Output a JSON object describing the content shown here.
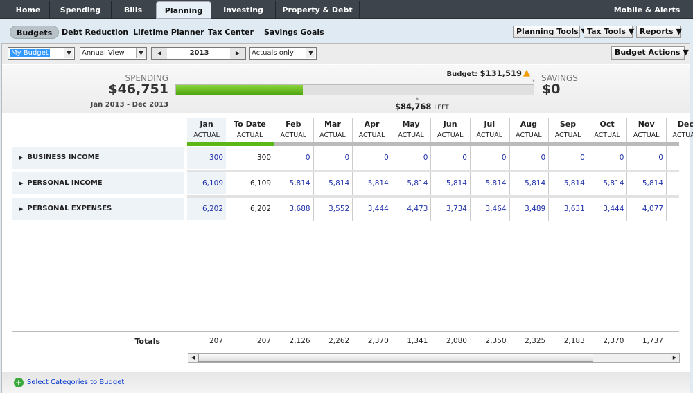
{
  "topnav": {
    "tabs": [
      "Home",
      "Spending",
      "Bills",
      "Planning",
      "Investing",
      "Property & Debt"
    ],
    "active": "Planning",
    "right": "Mobile & Alerts"
  },
  "subnav": {
    "items": [
      "Budgets",
      "Debt Reduction",
      "Lifetime Planner",
      "Tax Center",
      "Savings Goals"
    ],
    "active": "Budgets",
    "tools": [
      "Planning Tools",
      "Tax Tools",
      "Reports"
    ]
  },
  "toolbar": {
    "budget": "My Budget",
    "view": "Annual View",
    "year": "2013",
    "filter": "Actuals only",
    "actions": "Budget Actions"
  },
  "summary": {
    "spending_label": "SPENDING",
    "spending": "$46,751",
    "range": "Jan 2013 - Dec 2013",
    "budget_label": "Budget:",
    "budget": "$131,519",
    "left": "$84,768",
    "left_label": "LEFT",
    "savings_label": "SAVINGS",
    "savings": "$0",
    "progress_fraction": 0.355,
    "accent": "#5cb818",
    "warning_icon": "warning-triangle-icon"
  },
  "grid": {
    "columns": [
      {
        "m": "Jan",
        "s": "ACTUAL"
      },
      {
        "m": "To Date",
        "s": "ACTUAL"
      },
      {
        "m": "Feb",
        "s": "ACTUAL"
      },
      {
        "m": "Mar",
        "s": "ACTUAL"
      },
      {
        "m": "Apr",
        "s": "ACTUAL"
      },
      {
        "m": "May",
        "s": "ACTUAL"
      },
      {
        "m": "Jun",
        "s": "ACTUAL"
      },
      {
        "m": "Jul",
        "s": "ACTUAL"
      },
      {
        "m": "Aug",
        "s": "ACTUAL"
      },
      {
        "m": "Sep",
        "s": "ACTUAL"
      },
      {
        "m": "Oct",
        "s": "ACTUAL"
      },
      {
        "m": "Nov",
        "s": "ACTUAL"
      },
      {
        "m": "Dec",
        "s": "ACTUAL"
      }
    ],
    "rows": [
      {
        "label": "BUSINESS INCOME",
        "values": [
          "300",
          "300",
          "0",
          "0",
          "0",
          "0",
          "0",
          "0",
          "0",
          "0",
          "0",
          "0"
        ]
      },
      {
        "label": "PERSONAL INCOME",
        "values": [
          "6,109",
          "6,109",
          "5,814",
          "5,814",
          "5,814",
          "5,814",
          "5,814",
          "5,814",
          "5,814",
          "5,814",
          "5,814",
          "5,814"
        ]
      },
      {
        "label": "PERSONAL EXPENSES",
        "values": [
          "6,202",
          "6,202",
          "3,688",
          "3,552",
          "3,444",
          "4,473",
          "3,734",
          "3,464",
          "3,489",
          "3,631",
          "3,444",
          "4,077"
        ]
      }
    ],
    "totals_label": "Totals",
    "totals": [
      "207",
      "207",
      "2,126",
      "2,262",
      "2,370",
      "1,341",
      "2,080",
      "2,350",
      "2,325",
      "2,183",
      "2,370",
      "1,737"
    ]
  },
  "footer": {
    "link": "Select Categories to Budget"
  }
}
